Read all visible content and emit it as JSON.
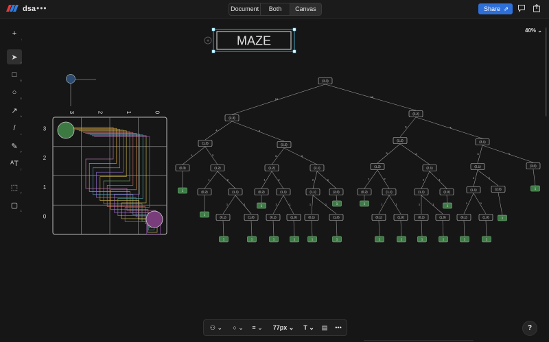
{
  "app": {
    "name": "dsa",
    "more": "•••"
  },
  "view_toggle": {
    "document": "Document",
    "both": "Both",
    "canvas": "Canvas"
  },
  "share": {
    "label": "Share",
    "link_glyph": "⇗"
  },
  "zoom": {
    "label": "40% ⌄"
  },
  "tools": [
    {
      "name": "add-tool",
      "glyph": "+",
      "key": "/"
    },
    {
      "name": "select-tool",
      "glyph": "➤",
      "key": "V"
    },
    {
      "name": "rectangle-tool",
      "glyph": "□",
      "key": "R"
    },
    {
      "name": "ellipse-tool",
      "glyph": "○",
      "key": "O"
    },
    {
      "name": "arrow-tool",
      "glyph": "↗",
      "key": "A"
    },
    {
      "name": "line-tool",
      "glyph": "/",
      "key": "L"
    },
    {
      "name": "pen-tool",
      "glyph": "✎",
      "key": "P"
    },
    {
      "name": "text-tool",
      "glyph": "ᴬT",
      "key": "T"
    },
    {
      "name": "frame-tool",
      "glyph": "⬚",
      "key": "F"
    },
    {
      "name": "comment-tool",
      "glyph": "▢",
      "key": "C"
    }
  ],
  "bottom": {
    "shape": "⚇",
    "circle": "○",
    "stroke": "≡",
    "size": "77px",
    "text": "T",
    "comment": "▤",
    "more": "•••",
    "caret": "⌄"
  },
  "help": "?",
  "maze_title": "MAZE",
  "grid": {
    "col_labels": [
      "3",
      "2",
      "1",
      "0"
    ],
    "row_labels": [
      "3",
      "2",
      "1",
      "0"
    ]
  },
  "colors": {
    "accent": "#2f6fd8",
    "selection": "#4fc3e6",
    "leaf": "#3d7a45",
    "start": "#3c7a42",
    "end": "#7a3d7c",
    "small": "#2c4a72"
  },
  "tree": {
    "nodes": [
      {
        "id": "r",
        "label": "(3,3)"
      },
      {
        "id": "a",
        "label": "(2,3)"
      },
      {
        "id": "b",
        "label": "(3,2)"
      },
      {
        "id": "c",
        "label": "(1,3)"
      },
      {
        "id": "d",
        "label": "(2,2)"
      },
      {
        "id": "e",
        "label": "(2,2)"
      },
      {
        "id": "f",
        "label": "(3,1)"
      },
      {
        "id": "g",
        "label": "(0,3)"
      },
      {
        "id": "h",
        "label": "(1,2)"
      },
      {
        "id": "i",
        "label": "(1,2)"
      },
      {
        "id": "j",
        "label": "(2,1)"
      },
      {
        "id": "k",
        "label": "(1,2)"
      },
      {
        "id": "l",
        "label": "(2,1)"
      },
      {
        "id": "m",
        "label": "(2,1)"
      },
      {
        "id": "n",
        "label": "(3,0)"
      },
      {
        "id": "o",
        "label": "(0,2)"
      },
      {
        "id": "p",
        "label": "(1,1)"
      },
      {
        "id": "q",
        "label": "(0,2)"
      },
      {
        "id": "s",
        "label": "(1,1)"
      },
      {
        "id": "t",
        "label": "(1,1)"
      },
      {
        "id": "u",
        "label": "(2,0)"
      },
      {
        "id": "v",
        "label": "(0,2)"
      },
      {
        "id": "w",
        "label": "(1,1)"
      },
      {
        "id": "x",
        "label": "(1,1)"
      },
      {
        "id": "y",
        "label": "(2,0)"
      },
      {
        "id": "z",
        "label": "(1,1)"
      },
      {
        "id": "aa",
        "label": "(2,0)"
      },
      {
        "id": "p1",
        "label": "(0,1)"
      },
      {
        "id": "p2",
        "label": "(1,0)"
      },
      {
        "id": "s1",
        "label": "(0,1)"
      },
      {
        "id": "s2",
        "label": "(1,0)"
      },
      {
        "id": "t1",
        "label": "(0,1)"
      },
      {
        "id": "t2",
        "label": "(1,0)"
      },
      {
        "id": "w1",
        "label": "(0,1)"
      },
      {
        "id": "w2",
        "label": "(1,0)"
      },
      {
        "id": "x1",
        "label": "(0,1)"
      },
      {
        "id": "x2",
        "label": "(1,0)"
      },
      {
        "id": "z1",
        "label": "(0,1)"
      },
      {
        "id": "z2",
        "label": "(1,0)"
      }
    ],
    "edges": [
      {
        "from": "r",
        "to": "a",
        "label": "10"
      },
      {
        "from": "r",
        "to": "b",
        "label": "10"
      },
      {
        "from": "a",
        "to": "c",
        "label": "4"
      },
      {
        "from": "a",
        "to": "d",
        "label": "6"
      },
      {
        "from": "b",
        "to": "e",
        "label": "6"
      },
      {
        "from": "b",
        "to": "f",
        "label": "4"
      },
      {
        "from": "c",
        "to": "g",
        "label": "1"
      },
      {
        "from": "c",
        "to": "h",
        "label": "3"
      },
      {
        "from": "d",
        "to": "i",
        "label": "3"
      },
      {
        "from": "d",
        "to": "j",
        "label": "3"
      },
      {
        "from": "e",
        "to": "k",
        "label": "3"
      },
      {
        "from": "e",
        "to": "l",
        "label": "3"
      },
      {
        "from": "f",
        "to": "m",
        "label": "3"
      },
      {
        "from": "f",
        "to": "n",
        "label": "1"
      },
      {
        "from": "g",
        "to": "L1",
        "label": ""
      },
      {
        "from": "h",
        "to": "o",
        "label": "1"
      },
      {
        "from": "h",
        "to": "p",
        "label": "2"
      },
      {
        "from": "i",
        "to": "q",
        "label": "1"
      },
      {
        "from": "i",
        "to": "s",
        "label": "2"
      },
      {
        "from": "j",
        "to": "t",
        "label": "2"
      },
      {
        "from": "j",
        "to": "u",
        "label": "1"
      },
      {
        "from": "k",
        "to": "v",
        "label": "1"
      },
      {
        "from": "k",
        "to": "w",
        "label": "2"
      },
      {
        "from": "l",
        "to": "x",
        "label": "2"
      },
      {
        "from": "l",
        "to": "y",
        "label": "1"
      },
      {
        "from": "m",
        "to": "z",
        "label": "2"
      },
      {
        "from": "m",
        "to": "aa",
        "label": "1"
      },
      {
        "from": "n",
        "to": "L2",
        "label": ""
      },
      {
        "from": "o",
        "to": "L3",
        "label": ""
      },
      {
        "from": "p",
        "to": "p1",
        "label": "1"
      },
      {
        "from": "p",
        "to": "p2",
        "label": "1"
      },
      {
        "from": "q",
        "to": "L4",
        "label": ""
      },
      {
        "from": "s",
        "to": "s1",
        "label": "1"
      },
      {
        "from": "s",
        "to": "s2",
        "label": "1"
      },
      {
        "from": "t",
        "to": "t1",
        "label": "1"
      },
      {
        "from": "t",
        "to": "t2",
        "label": "1"
      },
      {
        "from": "u",
        "to": "L5",
        "label": ""
      },
      {
        "from": "v",
        "to": "L6",
        "label": ""
      },
      {
        "from": "w",
        "to": "w1",
        "label": "1"
      },
      {
        "from": "w",
        "to": "w2",
        "label": "1"
      },
      {
        "from": "x",
        "to": "x1",
        "label": "1"
      },
      {
        "from": "x",
        "to": "x2",
        "label": "1"
      },
      {
        "from": "y",
        "to": "L7",
        "label": ""
      },
      {
        "from": "z",
        "to": "z1",
        "label": "1"
      },
      {
        "from": "z",
        "to": "z2",
        "label": "1"
      },
      {
        "from": "aa",
        "to": "L8",
        "label": ""
      },
      {
        "from": "p1",
        "to": "L9",
        "label": ""
      },
      {
        "from": "p2",
        "to": "L10",
        "label": ""
      },
      {
        "from": "s1",
        "to": "L11",
        "label": ""
      },
      {
        "from": "s2",
        "to": "L12",
        "label": ""
      },
      {
        "from": "t1",
        "to": "L13",
        "label": ""
      },
      {
        "from": "t2",
        "to": "L14",
        "label": ""
      },
      {
        "from": "w1",
        "to": "L15",
        "label": ""
      },
      {
        "from": "w2",
        "to": "L16",
        "label": ""
      },
      {
        "from": "x1",
        "to": "L17",
        "label": ""
      },
      {
        "from": "x2",
        "to": "L18",
        "label": ""
      },
      {
        "from": "z1",
        "to": "L19",
        "label": ""
      },
      {
        "from": "z2",
        "to": "L20",
        "label": ""
      }
    ],
    "leaf_label": "1"
  }
}
